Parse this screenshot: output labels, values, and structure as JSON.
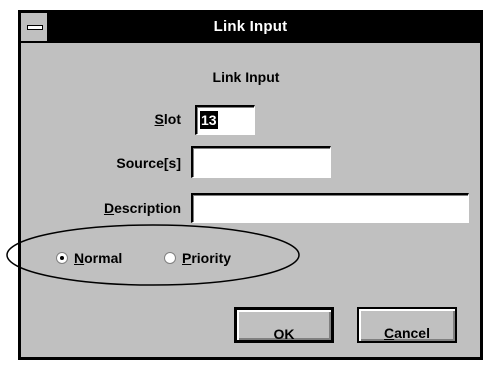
{
  "window": {
    "title": "Link Input"
  },
  "dialog": {
    "heading": "Link Input",
    "slot": {
      "label_mnemonic": "S",
      "label_rest": "lot",
      "value": "13"
    },
    "sources": {
      "label": "Source[s]",
      "value": ""
    },
    "description": {
      "label_mnemonic": "D",
      "label_rest": "escription",
      "value": ""
    },
    "radios": [
      {
        "mnemonic": "N",
        "rest": "ormal",
        "checked": true
      },
      {
        "mnemonic": "P",
        "rest": "riority",
        "checked": false
      }
    ],
    "buttons": {
      "ok": {
        "mnemonic": "O",
        "rest": "K"
      },
      "cancel": {
        "mnemonic": "C",
        "rest": "ancel"
      }
    }
  }
}
